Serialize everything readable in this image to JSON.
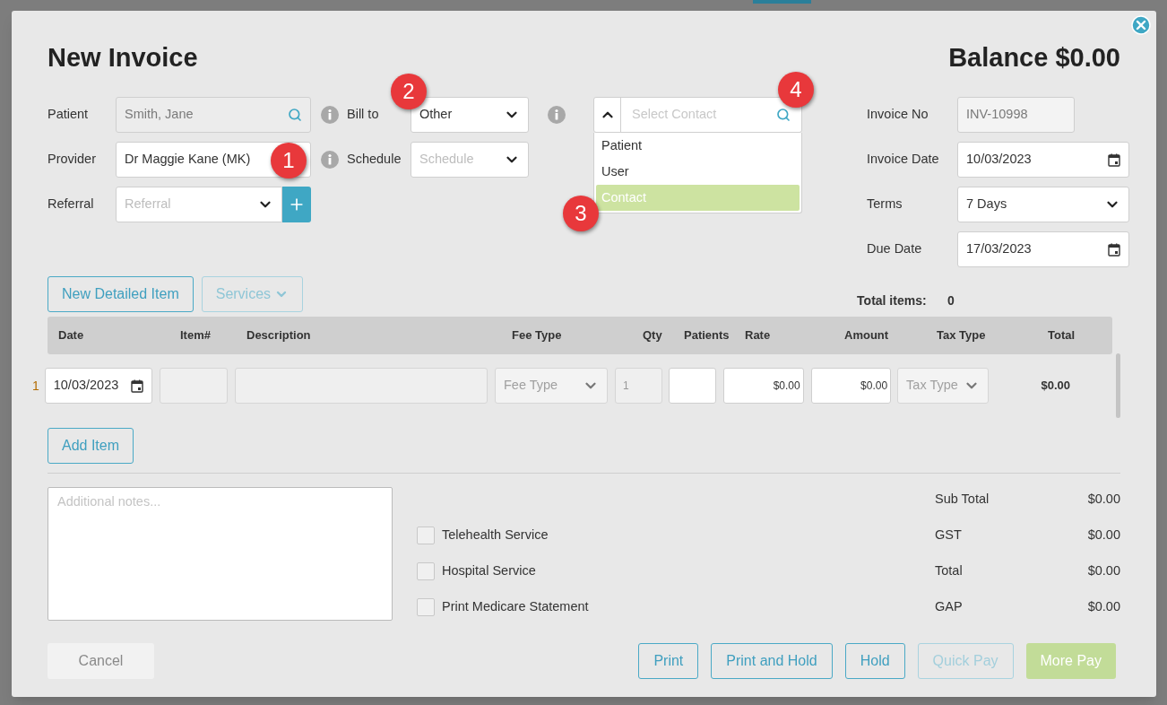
{
  "dialog": {
    "title": "New Invoice",
    "balance": "Balance $0.00"
  },
  "left_fields": [
    {
      "label": "Patient",
      "kind": "search",
      "value": "Smith, Jane",
      "disabled": true,
      "info": true
    },
    {
      "label": "Provider",
      "kind": "text",
      "value": "Dr Maggie Kane (MK)",
      "info": true
    },
    {
      "label": "Referral",
      "kind": "select-add",
      "placeholder": "Referral",
      "info": false
    }
  ],
  "middle_fields": [
    {
      "label": "Bill to",
      "kind": "select",
      "value": "Other",
      "info": true
    },
    {
      "label": "Schedule",
      "kind": "select",
      "placeholder": "Schedule",
      "info": false
    }
  ],
  "contact": {
    "placeholder": "Select Contact",
    "expanded": true,
    "options": [
      {
        "label": "Patient",
        "selected": false
      },
      {
        "label": "User",
        "selected": false
      },
      {
        "label": "Contact",
        "selected": true
      }
    ]
  },
  "right_fields": [
    {
      "label": "Invoice No",
      "kind": "readonly",
      "value": "INV-10998"
    },
    {
      "label": "Invoice Date",
      "kind": "date",
      "value": "10/03/2023"
    },
    {
      "label": "Terms",
      "kind": "select",
      "value": "7 Days"
    },
    {
      "label": "Due Date",
      "kind": "date",
      "value": "17/03/2023"
    }
  ],
  "item_buttons": [
    {
      "label": "New Detailed Item",
      "disabled": false,
      "dropdown": false
    },
    {
      "label": "Services",
      "disabled": true,
      "dropdown": true
    }
  ],
  "total_items": {
    "label": "Total items:",
    "value": "0"
  },
  "table": {
    "columns": [
      "Date",
      "Item#",
      "Description",
      "Fee Type",
      "Qty",
      "Patients",
      "Rate",
      "Amount",
      "Tax Type",
      "Total"
    ],
    "rows": [
      {
        "number": "1",
        "date": "10/03/2023",
        "fee_type_placeholder": "Fee Type",
        "qty": "1",
        "rate": "$0.00",
        "amount": "$0.00",
        "tax_type_placeholder": "Tax Type",
        "total": "$0.00"
      }
    ]
  },
  "add_item": "Add Item",
  "notes": {
    "placeholder": "Additional notes..."
  },
  "options": [
    {
      "label": "Telehealth Service",
      "checked": false
    },
    {
      "label": "Hospital Service",
      "checked": false
    },
    {
      "label": "Print Medicare Statement",
      "checked": false
    }
  ],
  "totals": [
    {
      "label": "Sub Total",
      "value": "$0.00"
    },
    {
      "label": "GST",
      "value": "$0.00"
    },
    {
      "label": "Total",
      "value": "$0.00"
    },
    {
      "label": "GAP",
      "value": "$0.00"
    }
  ],
  "footer": {
    "cancel": "Cancel",
    "actions": [
      {
        "label": "Print",
        "kind": "outline"
      },
      {
        "label": "Print and Hold",
        "kind": "outline"
      },
      {
        "label": "Hold",
        "kind": "outline"
      },
      {
        "label": "Quick Pay",
        "kind": "disabled"
      },
      {
        "label": "More Pay",
        "kind": "primary"
      }
    ]
  },
  "callouts": [
    "1",
    "2",
    "3",
    "4"
  ]
}
